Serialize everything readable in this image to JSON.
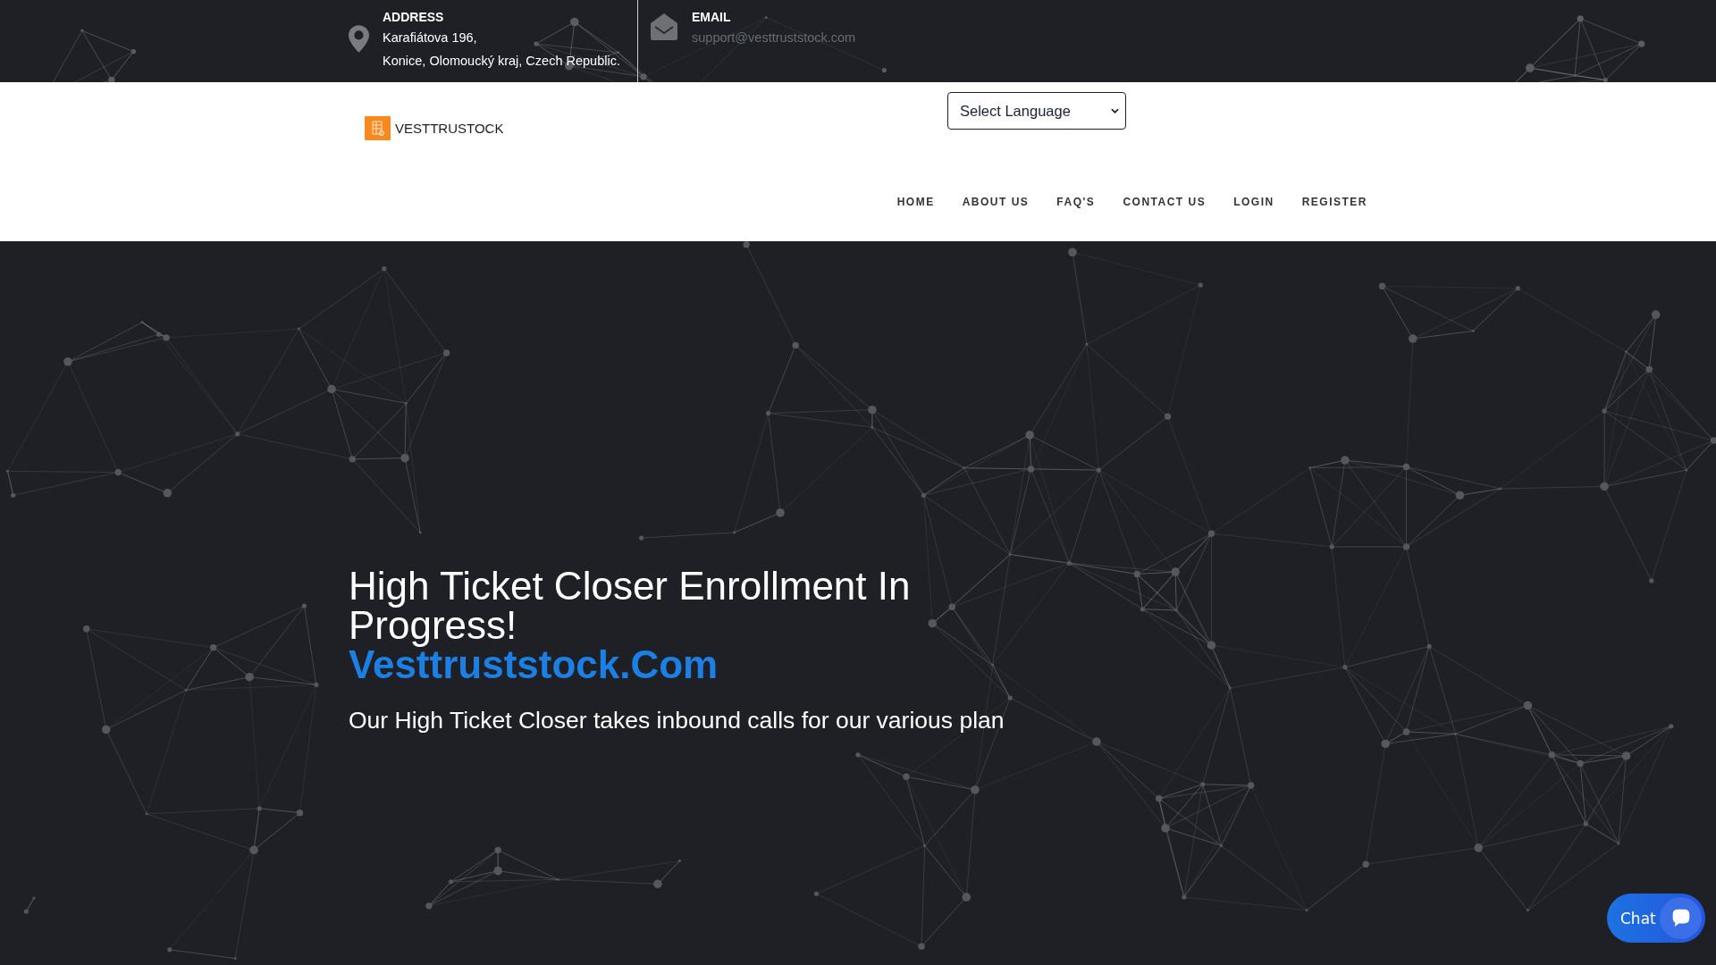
{
  "top_bar": {
    "address": {
      "label": "ADDRESS",
      "lines": [
        "Karafiátova 196,",
        "Konice, Olomoucký kraj, Czech Republic."
      ]
    },
    "email": {
      "label": "EMAIL",
      "value": "support@vesttruststock.com"
    }
  },
  "header": {
    "logo_text": "VESTTRUSTOCK",
    "language_select": {
      "value": "Select Language"
    },
    "nav": [
      "HOME",
      "ABOUT US",
      "FAQ'S",
      "CONTACT US",
      "LOGIN",
      "REGISTER"
    ]
  },
  "hero": {
    "title": "High Ticket Closer Enrollment In Progress!",
    "highlight": "Vesttruststock.Com",
    "subtitle": "Our High Ticket Closer takes inbound calls for our various plan"
  },
  "chat_widget": {
    "label": "Chat"
  }
}
